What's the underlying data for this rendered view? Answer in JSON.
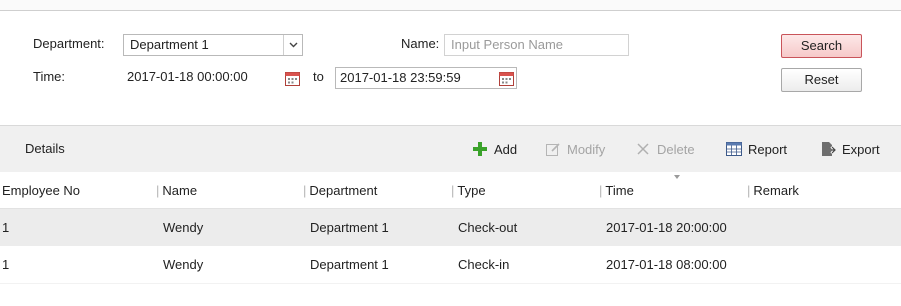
{
  "filter": {
    "department_label": "Department:",
    "department_value": "Department 1",
    "name_label": "Name:",
    "name_placeholder": "Input Person Name",
    "time_label": "Time:",
    "time_start": "2017-01-18 00:00:00",
    "to_label": "to",
    "time_end": "2017-01-18 23:59:59",
    "search_label": "Search",
    "reset_label": "Reset"
  },
  "toolbar": {
    "title": "Details",
    "add_label": "Add",
    "modify_label": "Modify",
    "delete_label": "Delete",
    "report_label": "Report",
    "export_label": "Export"
  },
  "table": {
    "columns": [
      "Employee No",
      "Name",
      "Department",
      "Type",
      "Time",
      "Remark"
    ],
    "rows": [
      {
        "employee_no": "1",
        "name": "Wendy",
        "department": "Department 1",
        "type": "Check-out",
        "time": "2017-01-18 20:00:00",
        "remark": ""
      },
      {
        "employee_no": "1",
        "name": "Wendy",
        "department": "Department 1",
        "type": "Check-in",
        "time": "2017-01-18 08:00:00",
        "remark": ""
      }
    ]
  },
  "colors": {
    "add_icon": "#3aa22a",
    "search_button_border": "#c9545a",
    "selected_row": "#ececec"
  }
}
